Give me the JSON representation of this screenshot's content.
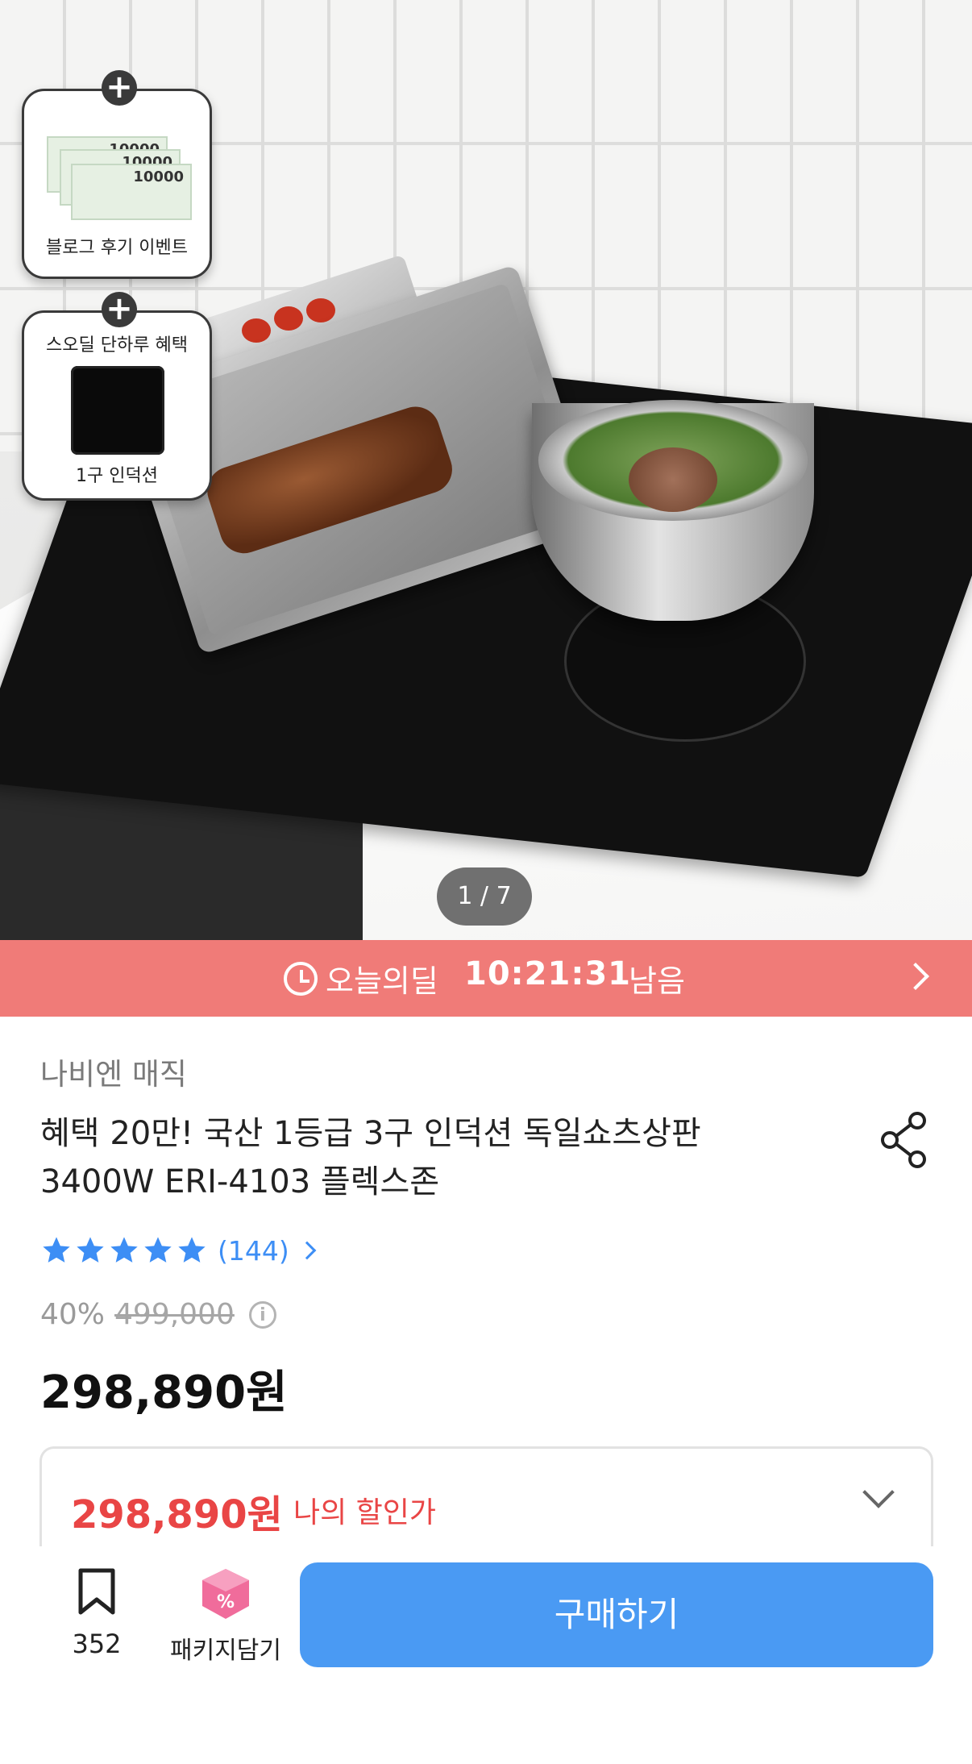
{
  "hero": {
    "pager": "1 / 7",
    "promo_blog": {
      "label": "블로그 후기 이벤트",
      "vouchers": [
        "10000",
        "10000",
        "10000"
      ]
    },
    "promo_induction": {
      "title": "스오딜 단하루 혜택",
      "label": "1구 인덕션"
    }
  },
  "deal": {
    "label": "오늘의딜",
    "time": "10:21:31",
    "suffix": "남음"
  },
  "product": {
    "brand": "나비엔 매직",
    "title": "혜택 20만! 국산 1등급 3구 인덕션 독일쇼츠상판 3400W ERI-4103 플렉스존",
    "rating_stars": 5,
    "review_count": "(144)",
    "discount_rate": "40%",
    "original_price": "499,000",
    "price": "298,890원",
    "my_price": "298,890원",
    "my_price_label": "나의 할인가"
  },
  "bottom": {
    "wish_count": "352",
    "package_label": "패키지담기",
    "buy_label": "구매하기"
  },
  "colors": {
    "deal_bar": "#f07b78",
    "buy_button": "#4a9af3",
    "star": "#3d8ef5",
    "my_price": "#e94545"
  }
}
